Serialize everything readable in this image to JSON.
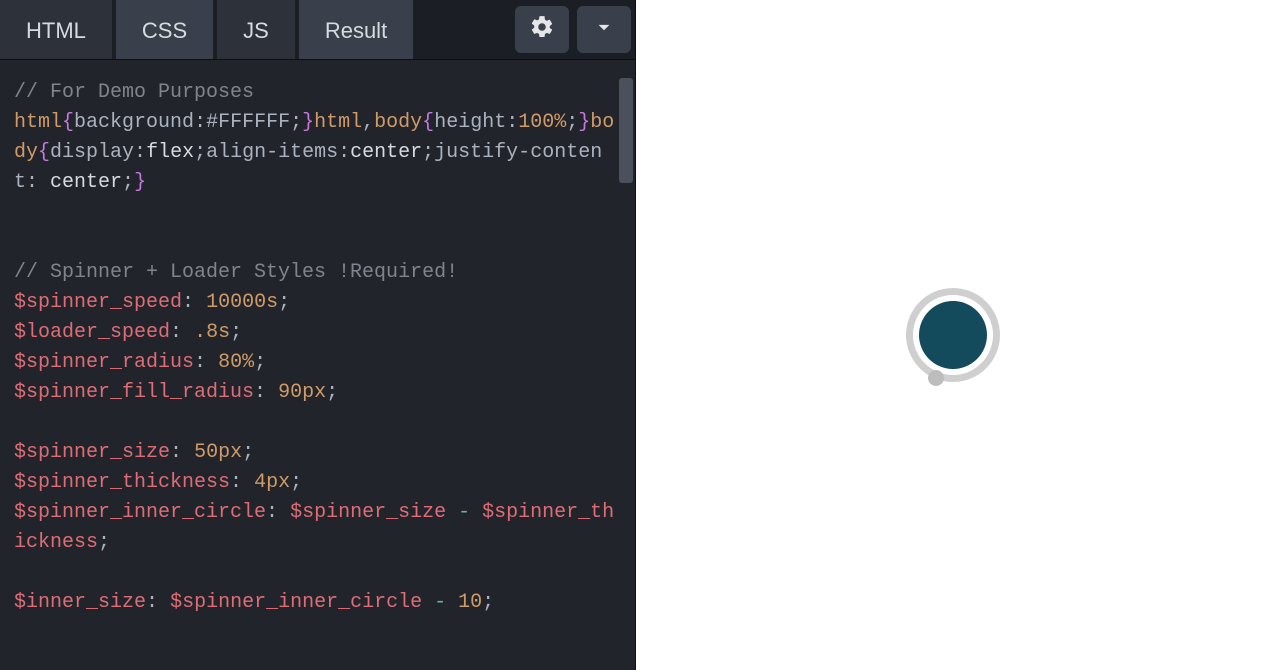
{
  "tabs": {
    "html": "HTML",
    "css": "CSS",
    "js": "JS",
    "result": "Result"
  },
  "activeTab": "CSS",
  "icons": {
    "settings": "gear-icon",
    "collapse": "chevron-down-icon"
  },
  "code": {
    "comment1": "// For Demo Purposes",
    "l2_a": "html",
    "l2_b": "{",
    "l2_c": "background",
    "l2_d": ":",
    "l2_e": "#FFFFFF",
    "l2_f": ";",
    "l2_g": "}",
    "l2_h": "html",
    "l2_i": ",",
    "l2_j": "body",
    "l2_k": "{",
    "l2_l": "height",
    "l2_m": ":",
    "l2_n": "100%",
    "l2_o": ";",
    "l2_p": "}",
    "l2_q": "body",
    "l2_r": "{",
    "l2_s": "display",
    "l2_t": ":",
    "l2_u": "flex",
    "l2_v": ";",
    "l2_w": "align-items",
    "l2_x": ":",
    "l2_y": "center",
    "l2_z": ";",
    "l2_aa": "justify-content",
    "l2_ab": ":",
    "l2_ac": " center",
    "l2_ad": ";",
    "l2_ae": "}",
    "comment2": "// Spinner + Loader Styles !Required!",
    "v1_name": "$spinner_speed",
    "v1_val": "10000s",
    "v2_name": "$loader_speed",
    "v2_val": ".8s",
    "v3_name": "$spinner_radius",
    "v3_val": "80%",
    "v4_name": "$spinner_fill_radius",
    "v4_val": "90px",
    "v5_name": "$spinner_size",
    "v5_val": "50px",
    "v6_name": "$spinner_thickness",
    "v6_val": "4px",
    "v7_name": "$spinner_inner_circle",
    "v7_expr_a": "$spinner_size",
    "v7_op": " - ",
    "v7_expr_b": "$spinner_thickness",
    "v8_name": "$inner_size",
    "v8_expr_a": "$spinner_inner_circle",
    "v8_op": " - ",
    "v8_val": "10",
    "colon": ":",
    "semi": ";"
  },
  "preview": {
    "ringColor": "#cfcfcf",
    "coreColor": "#134a5c",
    "dotColor": "#bdbdbd"
  }
}
